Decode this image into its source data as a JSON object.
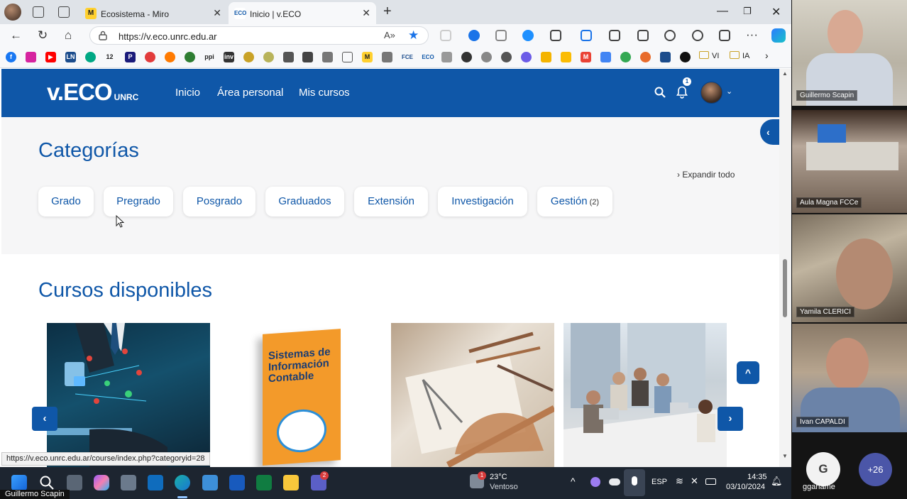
{
  "browser": {
    "tabs": [
      {
        "label": "Ecosistema - Miro",
        "favicon": "miro-favicon"
      },
      {
        "label": "Inicio | v.ECO",
        "favicon": "veco-favicon"
      }
    ],
    "url": "https://v.eco.unrc.edu.ar",
    "bookmark_folders": [
      "VI",
      "IA"
    ],
    "bookmark_texts": [
      "LN",
      "12",
      "P",
      "ppi",
      "inv",
      "FCE",
      "ECO"
    ],
    "status_url": "https://v.eco.unrc.edu.ar/course/index.php?categoryid=28"
  },
  "site": {
    "logo_main": "v.ECO",
    "logo_sub": "UNRC",
    "nav": [
      "Inicio",
      "Área personal",
      "Mis cursos"
    ],
    "notifications_count": "1"
  },
  "categories": {
    "title": "Categorías",
    "expand_label": "Expandir todo",
    "items": [
      {
        "label": "Grado",
        "count": ""
      },
      {
        "label": "Pregrado",
        "count": ""
      },
      {
        "label": "Posgrado",
        "count": ""
      },
      {
        "label": "Graduados",
        "count": ""
      },
      {
        "label": "Extensión",
        "count": ""
      },
      {
        "label": "Investigación",
        "count": ""
      },
      {
        "label": "Gestión",
        "count": "(2)"
      }
    ]
  },
  "courses": {
    "title": "Cursos disponibles",
    "book_title": "Sistemas de Información Contable"
  },
  "taskbar": {
    "weather_temp": "23°C",
    "weather_desc": "Ventoso",
    "weather_badge": "1",
    "teams_badge": "2",
    "language": "ESP",
    "time": "14:35",
    "date": "03/10/2024"
  },
  "meeting": {
    "participants": [
      {
        "name": "Guillermo Scapin"
      },
      {
        "name": "Aula Magna FCCe"
      },
      {
        "name": "Yamila CLERICI"
      },
      {
        "name": "Ivan CAPALDI"
      }
    ],
    "avatar_initial": "G",
    "avatar_name": "gganame",
    "more_count": "+26",
    "presenter_label": "Guillermo Scapin"
  }
}
